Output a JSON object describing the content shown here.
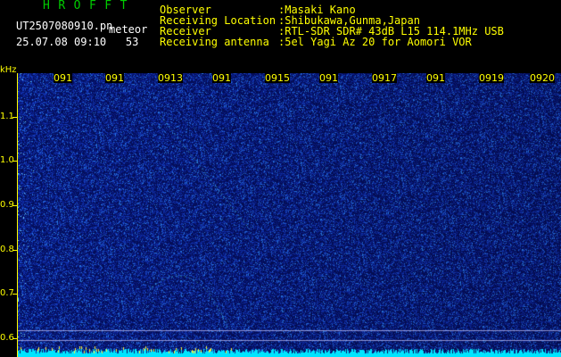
{
  "header": {
    "logo": "HROFFT",
    "filename": "UT2507080910.pn",
    "mode": "meteor",
    "timestamp": "25.07.08 09:10",
    "sec_value": "53",
    "info": [
      {
        "label": "Observer",
        "value": ":Masaki Kano"
      },
      {
        "label": "Receiving Location",
        "value": ":Shibukawa,Gunma,Japan"
      },
      {
        "label": "Receiver",
        "value": ":RTL-SDR SDR# 43dB L15 114.1MHz USB"
      },
      {
        "label": "Receiving antenna",
        "value": ":5el Yagi Az 20 for Aomori VOR"
      }
    ]
  },
  "colors": {
    "logo": "#00cc00",
    "header_text": "#ffffff",
    "info_text": "#ffff00",
    "axis": "#ffff00",
    "background": "#000000",
    "noise_base": "#0b1e8a",
    "noise_bright": "#3fb0ff",
    "baseline": "#00e5ff"
  },
  "spectrogram": {
    "unit_label": "kHz",
    "y_ticks": [
      "1.1",
      "1.0",
      "0.9",
      "0.8",
      "0.7",
      "0.6"
    ],
    "x_ticks": [
      "091",
      "091",
      "0913",
      "091",
      "0915",
      "091",
      "0917",
      "091",
      "0919",
      "0920"
    ]
  }
}
